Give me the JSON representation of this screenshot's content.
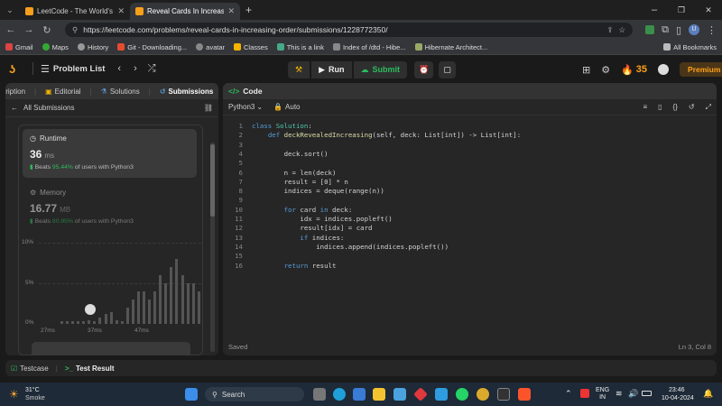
{
  "browser": {
    "tabs": [
      {
        "title": "LeetCode - The World's Leading",
        "active": false
      },
      {
        "title": "Reveal Cards In Increasing Orde",
        "active": true
      }
    ],
    "url": "https://leetcode.com/problems/reveal-cards-in-increasing-order/submissions/1228772350/",
    "bookmarks": [
      "Gmail",
      "Maps",
      "History",
      "Git - Downloading...",
      "avatar",
      "Classes",
      "This is a link",
      "Index of /dtd - Hibe...",
      "Hibernate Architect..."
    ],
    "all_bookmarks": "All Bookmarks"
  },
  "header": {
    "problem_list": "Problem List",
    "run": "Run",
    "submit": "Submit",
    "streak": "35",
    "premium": "Premium"
  },
  "left": {
    "tabs": [
      "Description",
      "Editorial",
      "Solutions",
      "Submissions"
    ],
    "all_submissions": "All Submissions",
    "runtime_label": "Runtime",
    "runtime_value": "36",
    "runtime_unit": "ms",
    "runtime_beats": "Beats",
    "runtime_pct": "95.44%",
    "runtime_suffix": "of users with Python3",
    "memory_label": "Memory",
    "memory_value": "16.77",
    "memory_unit": "MB",
    "memory_beats": "Beats",
    "memory_pct": "80.95%",
    "memory_suffix": "of users with Python3",
    "chart_y": [
      "10%",
      "5%",
      "0%"
    ],
    "chart_x": [
      "27ms",
      "37ms",
      "47ms"
    ]
  },
  "chart_data": {
    "type": "bar",
    "categories": [],
    "values": [
      0.3,
      0.3,
      0.3,
      0.3,
      0.3,
      0.5,
      0.3,
      0.8,
      1.2,
      1.5,
      0.5,
      0.3,
      2,
      3,
      4,
      4,
      3,
      4,
      6,
      5,
      7,
      8,
      6,
      5,
      5,
      4,
      3,
      2,
      1.2
    ],
    "ylim": [
      0,
      10
    ],
    "ylabel": "",
    "xlabel": "",
    "y_ticks": [
      "10%",
      "5%",
      "0%"
    ],
    "x_ticks": [
      "27ms",
      "37ms",
      "47ms"
    ]
  },
  "right": {
    "title": "Code",
    "language": "Python3",
    "auto": "Auto",
    "saved": "Saved",
    "cursor": "Ln 3, Col 8",
    "lines": [
      "class Solution:",
      "    def deckRevealedIncreasing(self, deck: List[int]) -> List[int]:",
      "",
      "        deck.sort()",
      "",
      "        n = len(deck)",
      "        result = [0] * n",
      "        indices = deque(range(n))",
      "",
      "        for card in deck:",
      "            idx = indices.popleft()",
      "            result[idx] = card",
      "            if indices:",
      "                indices.append(indices.popleft())",
      "",
      "        return result"
    ]
  },
  "bottom": {
    "testcase": "Testcase",
    "test_result": "Test Result"
  },
  "taskbar": {
    "temp": "31°C",
    "weather": "Smoke",
    "search": "Search",
    "lang": "ENG",
    "region": "IN",
    "time": "23:46",
    "date": "10-04-2024"
  }
}
